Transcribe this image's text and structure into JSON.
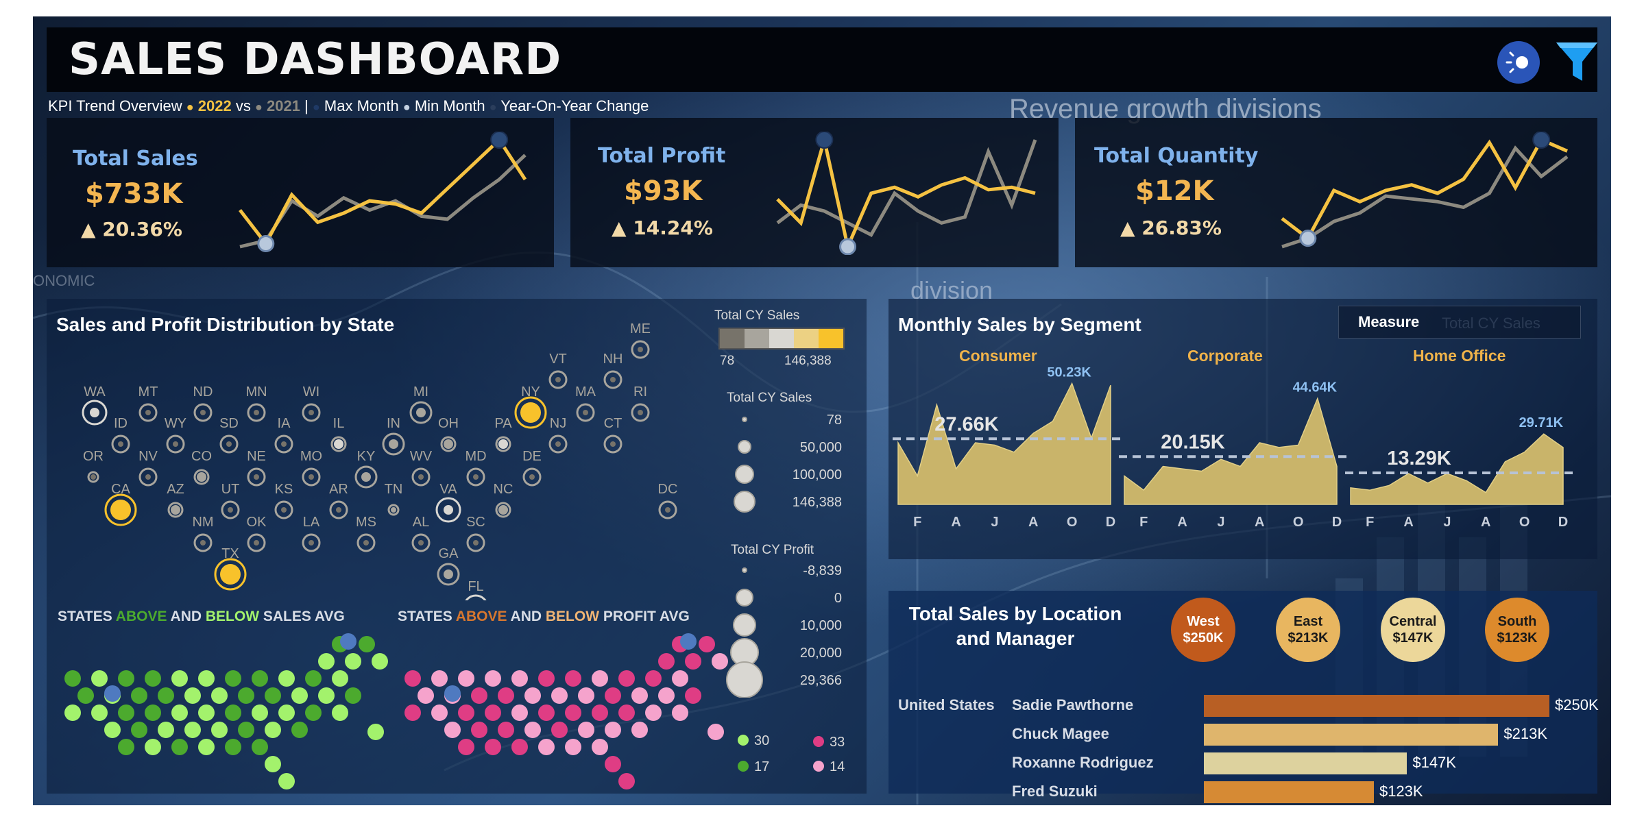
{
  "header": {
    "title": "SALES DASHBOARD"
  },
  "subheader": {
    "prefix": "KPI Trend Overview",
    "year_current": "2022",
    "vs": "vs",
    "year_previous": "2021",
    "separator": "|",
    "max_month": "Max Month",
    "min_month": "Min Month",
    "yoy": "Year-On-Year Change"
  },
  "background_text": {
    "revenue": "Revenue growth divisions",
    "division": "division",
    "onomic": "ONOMIC"
  },
  "kpis": [
    {
      "title": "Total Sales",
      "value": "$733K",
      "change": "▲ 20.36%",
      "series_2022": [
        52,
        30,
        62,
        44,
        50,
        58,
        56,
        50,
        66,
        82,
        98,
        72
      ],
      "series_2021": [
        28,
        32,
        58,
        48,
        60,
        52,
        58,
        48,
        46,
        60,
        72,
        88
      ]
    },
    {
      "title": "Total Profit",
      "value": "$93K",
      "change": "▲ 14.24%",
      "series_2022": [
        50,
        30,
        100,
        10,
        55,
        60,
        52,
        62,
        68,
        58,
        60,
        55
      ],
      "series_2021": [
        30,
        45,
        40,
        30,
        20,
        55,
        40,
        30,
        35,
        90,
        45,
        100
      ]
    },
    {
      "title": "Total Quantity",
      "value": "$12K",
      "change": "▲ 26.83%",
      "series_2022": [
        42,
        28,
        62,
        54,
        62,
        66,
        60,
        70,
        96,
        64,
        98,
        90
      ],
      "series_2021": [
        22,
        28,
        40,
        46,
        58,
        56,
        54,
        50,
        60,
        92,
        72,
        86
      ]
    }
  ],
  "state_map": {
    "title": "Sales and Profit Distribution by State",
    "states": [
      {
        "abbr": "WA",
        "sales": 90000,
        "profit": 15000
      },
      {
        "abbr": "MT",
        "sales": 5000,
        "profit": 1000
      },
      {
        "abbr": "ND",
        "sales": 900,
        "profit": 200
      },
      {
        "abbr": "MN",
        "sales": 20000,
        "profit": 6000
      },
      {
        "abbr": "WI",
        "sales": 25000,
        "profit": 6000
      },
      {
        "abbr": "MI",
        "sales": 40000,
        "profit": 12000
      },
      {
        "abbr": "NY",
        "sales": 146388,
        "profit": 29366
      },
      {
        "abbr": "VT",
        "sales": 9000,
        "profit": 2000
      },
      {
        "abbr": "NH",
        "sales": 7000,
        "profit": 1500
      },
      {
        "abbr": "ME",
        "sales": 1200,
        "profit": 400
      },
      {
        "abbr": "MA",
        "sales": 18000,
        "profit": 3000
      },
      {
        "abbr": "RI",
        "sales": 13000,
        "profit": 3500
      },
      {
        "abbr": "CT",
        "sales": 11000,
        "profit": 3500
      },
      {
        "abbr": "NJ",
        "sales": 25000,
        "profit": 9000
      },
      {
        "abbr": "PA",
        "sales": 70000,
        "profit": -8839
      },
      {
        "abbr": "OH",
        "sales": 50000,
        "profit": -5000
      },
      {
        "abbr": "IN",
        "sales": 45000,
        "profit": 14000
      },
      {
        "abbr": "IL",
        "sales": 60000,
        "profit": -7000
      },
      {
        "abbr": "IA",
        "sales": 4500,
        "profit": 1000
      },
      {
        "abbr": "SD",
        "sales": 1300,
        "profit": 400
      },
      {
        "abbr": "WY",
        "sales": 1600,
        "profit": 100
      },
      {
        "abbr": "ID",
        "sales": 4000,
        "profit": 800
      },
      {
        "abbr": "OR",
        "sales": 17000,
        "profit": -1000
      },
      {
        "abbr": "NV",
        "sales": 16000,
        "profit": 3300
      },
      {
        "abbr": "CA",
        "sales": 140000,
        "profit": 29000
      },
      {
        "abbr": "CO",
        "sales": 32000,
        "profit": -6500
      },
      {
        "abbr": "NE",
        "sales": 7000,
        "profit": 2000
      },
      {
        "abbr": "MO",
        "sales": 22000,
        "profit": 6400
      },
      {
        "abbr": "KY",
        "sales": 37000,
        "profit": 11000
      },
      {
        "abbr": "WV",
        "sales": 1200,
        "profit": 200
      },
      {
        "abbr": "MD",
        "sales": 24000,
        "profit": 7000
      },
      {
        "abbr": "DE",
        "sales": 27000,
        "profit": 9900
      },
      {
        "abbr": "AZ",
        "sales": 35000,
        "profit": -3400
      },
      {
        "abbr": "UT",
        "sales": 11000,
        "profit": 2500
      },
      {
        "abbr": "KS",
        "sales": 3000,
        "profit": 800
      },
      {
        "abbr": "AR",
        "sales": 12000,
        "profit": 4000
      },
      {
        "abbr": "TN",
        "sales": 30000,
        "profit": -5000
      },
      {
        "abbr": "VA",
        "sales": 70000,
        "profit": 18000
      },
      {
        "abbr": "NC",
        "sales": 55000,
        "profit": -7500
      },
      {
        "abbr": "DC",
        "sales": 2800,
        "profit": 1000
      },
      {
        "abbr": "NM",
        "sales": 4800,
        "profit": 1200
      },
      {
        "abbr": "OK",
        "sales": 19000,
        "profit": 4800
      },
      {
        "abbr": "LA",
        "sales": 9000,
        "profit": 2200
      },
      {
        "abbr": "MS",
        "sales": 10000,
        "profit": 3200
      },
      {
        "abbr": "AL",
        "sales": 19000,
        "profit": 5800
      },
      {
        "abbr": "GA",
        "sales": 49000,
        "profit": 16000
      },
      {
        "abbr": "SC",
        "sales": 8500,
        "profit": 1800
      },
      {
        "abbr": "FL",
        "sales": 89000,
        "profit": -3400
      },
      {
        "abbr": "TX",
        "sales": 170000,
        "profit": -25000
      }
    ],
    "legend_sales": {
      "title": "Total CY Sales",
      "min": "78",
      "max": "146,388",
      "colors": [
        "#77736a",
        "#a8a59d",
        "#d9d7d2",
        "#ecd183",
        "#f8c22b"
      ]
    },
    "legend_size_sales": {
      "title": "Total CY Sales",
      "items": [
        "78",
        "50,000",
        "100,000",
        "146,388"
      ]
    },
    "legend_size_profit": {
      "title": "Total CY Profit",
      "items": [
        "-8,839",
        "0",
        "10,000",
        "20,000",
        "29,366"
      ]
    }
  },
  "above_below": {
    "sales_title_parts": [
      "STATES ",
      "ABOVE",
      " AND ",
      "BELOW",
      " SALES AVG"
    ],
    "profit_title_parts": [
      "STATES ",
      "ABOVE",
      " AND ",
      "BELOW",
      " PROFIT AVG"
    ],
    "sales_counts": [
      {
        "label": "30",
        "color": "#a3f26c"
      },
      {
        "label": "17",
        "color": "#4caa2e"
      }
    ],
    "profit_counts": [
      {
        "label": "33",
        "color": "#df3d84"
      },
      {
        "label": "14",
        "color": "#f5a3cc"
      }
    ],
    "colors": {
      "sales_above": "#4caa2e",
      "sales_below": "#a3f26c",
      "profit_above": "#d6772f",
      "profit_below": "#f0b574"
    }
  },
  "segments": {
    "title": "Monthly Sales by Segment",
    "measure_label": "Measure",
    "measure_value": "Total CY Sales",
    "month_ticks": [
      "F",
      "A",
      "J",
      "A",
      "O",
      "D"
    ],
    "items": [
      {
        "name": "Consumer",
        "avg": 27.66,
        "avg_label": "27.66K",
        "max_label": "50.23K",
        "values": [
          26,
          12,
          42,
          15,
          26,
          25,
          22,
          30,
          35,
          51,
          28,
          50.23
        ]
      },
      {
        "name": "Corporate",
        "avg": 20.15,
        "avg_label": "20.15K",
        "max_label": "44.64K",
        "values": [
          12,
          6,
          16,
          15,
          14,
          19,
          16,
          26,
          24,
          25,
          44.64,
          16
        ]
      },
      {
        "name": "Home Office",
        "avg": 13.29,
        "avg_label": "13.29K",
        "max_label": "29.71K",
        "values": [
          7,
          6,
          8,
          13,
          9,
          13,
          10,
          5,
          18,
          22,
          29.71,
          24
        ]
      }
    ],
    "ymax": 52
  },
  "location": {
    "title_line1": "Total Sales by Location",
    "title_line2": "and Manager",
    "regions": [
      {
        "name": "West",
        "value": "$250K",
        "color": "#c15a1c",
        "text": "#ffffff"
      },
      {
        "name": "East",
        "value": "$213K",
        "color": "#e8b660",
        "text": "#1a1a1a"
      },
      {
        "name": "Central",
        "value": "$147K",
        "color": "#ecd79a",
        "text": "#1a1a1a"
      },
      {
        "name": "South",
        "value": "$123K",
        "color": "#dd8a2c",
        "text": "#1a1a1a"
      }
    ],
    "country": "United States",
    "managers": [
      {
        "name": "Sadie Pawthorne",
        "value": 250,
        "label": "$250K",
        "color": "#b85f24"
      },
      {
        "name": "Chuck Magee",
        "value": 213,
        "label": "$213K",
        "color": "#dfb56c"
      },
      {
        "name": "Roxanne Rodriguez",
        "value": 147,
        "label": "$147K",
        "color": "#ddd29e"
      },
      {
        "name": "Fred Suzuki",
        "value": 123,
        "label": "$123K",
        "color": "#d68a34"
      }
    ]
  }
}
